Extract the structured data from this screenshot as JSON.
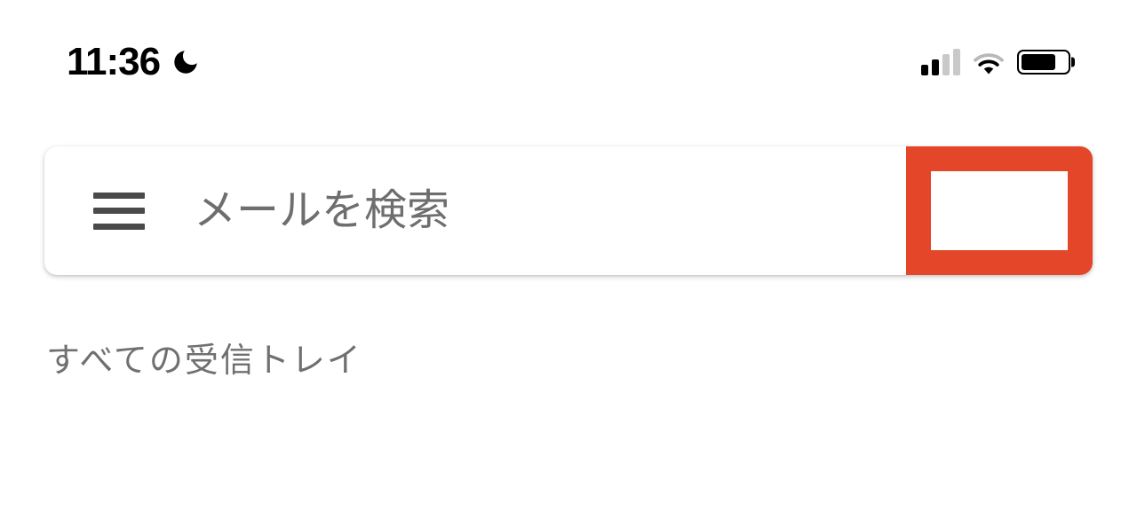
{
  "status": {
    "time": "11:36"
  },
  "search": {
    "placeholder": "メールを検索"
  },
  "section": {
    "label": "すべての受信トレイ"
  }
}
